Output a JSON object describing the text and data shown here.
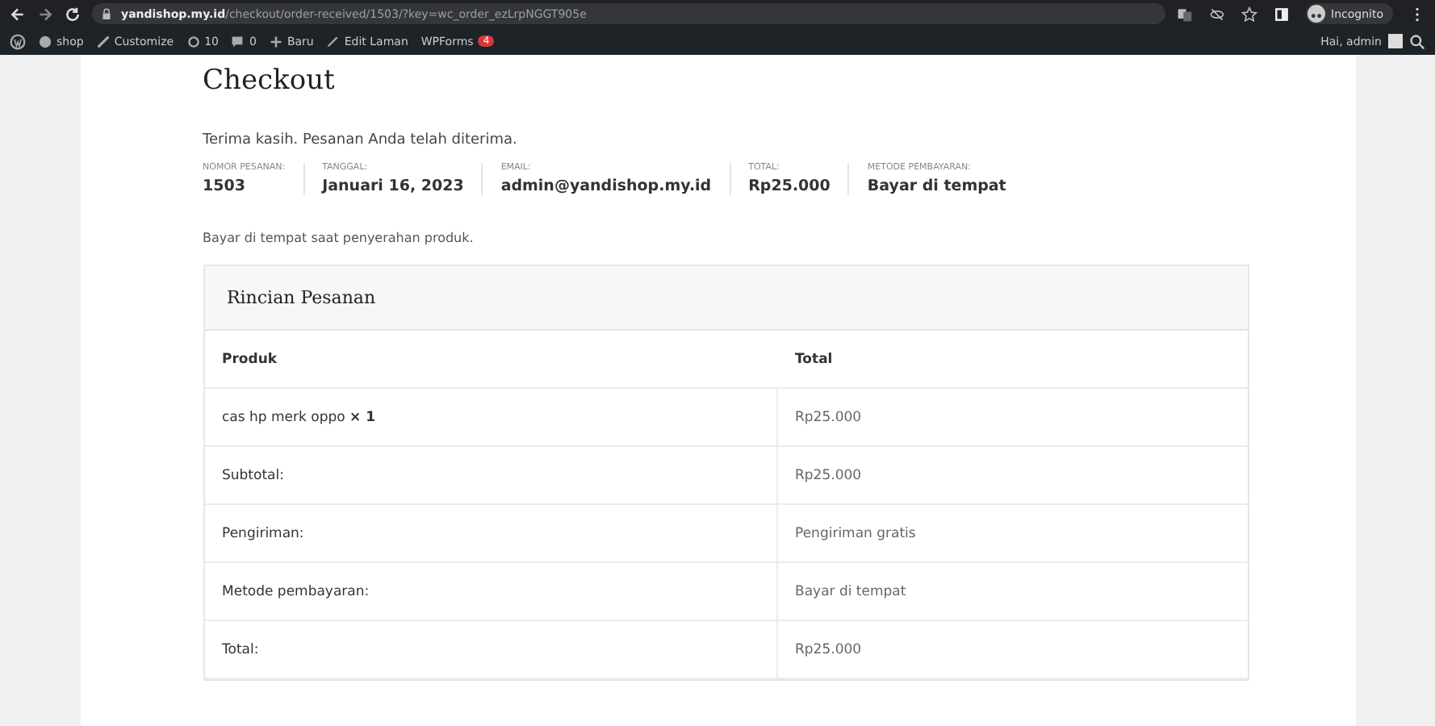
{
  "browser": {
    "url_host": "yandishop.my.id",
    "url_path": "/checkout/order-received/1503/?key=wc_order_ezLrpNGGT905e",
    "profile": "Incognito"
  },
  "admin_bar": {
    "items": [
      {
        "kind": "site",
        "label": "shop"
      },
      {
        "kind": "customize",
        "label": "Customize"
      },
      {
        "kind": "updates",
        "label": "10"
      },
      {
        "kind": "comments",
        "label": "0"
      },
      {
        "kind": "new",
        "label": "Baru"
      },
      {
        "kind": "edit",
        "label": "Edit Laman"
      },
      {
        "kind": "forms",
        "label": "WPForms",
        "badge": "4"
      }
    ],
    "greeting": "Hai, admin"
  },
  "page": {
    "title": "Checkout",
    "notice": "Terima kasih. Pesanan Anda telah diterima.",
    "overview": [
      {
        "label": "NOMOR PESANAN:",
        "value": "1503"
      },
      {
        "label": "TANGGAL:",
        "value": "Januari 16, 2023"
      },
      {
        "label": "EMAIL:",
        "value": "admin@yandishop.my.id"
      },
      {
        "label": "TOTAL:",
        "value": "Rp25.000"
      },
      {
        "label": "METODE PEMBAYARAN:",
        "value": "Bayar di tempat"
      }
    ],
    "payment_note": "Bayar di tempat saat penyerahan produk.",
    "details": {
      "title": "Rincian Pesanan",
      "columns": [
        "Produk",
        "Total"
      ],
      "rows": [
        {
          "label": "cas hp merk oppo **× 1**",
          "value": "Rp25.000"
        },
        {
          "label": "Subtotal:",
          "value": "Rp25.000"
        },
        {
          "label": "Pengiriman:",
          "value": "Pengiriman gratis"
        },
        {
          "label": "Metode pembayaran:",
          "value": "Bayar di tempat"
        },
        {
          "label": "Total:",
          "value": "Rp25.000"
        }
      ]
    }
  }
}
